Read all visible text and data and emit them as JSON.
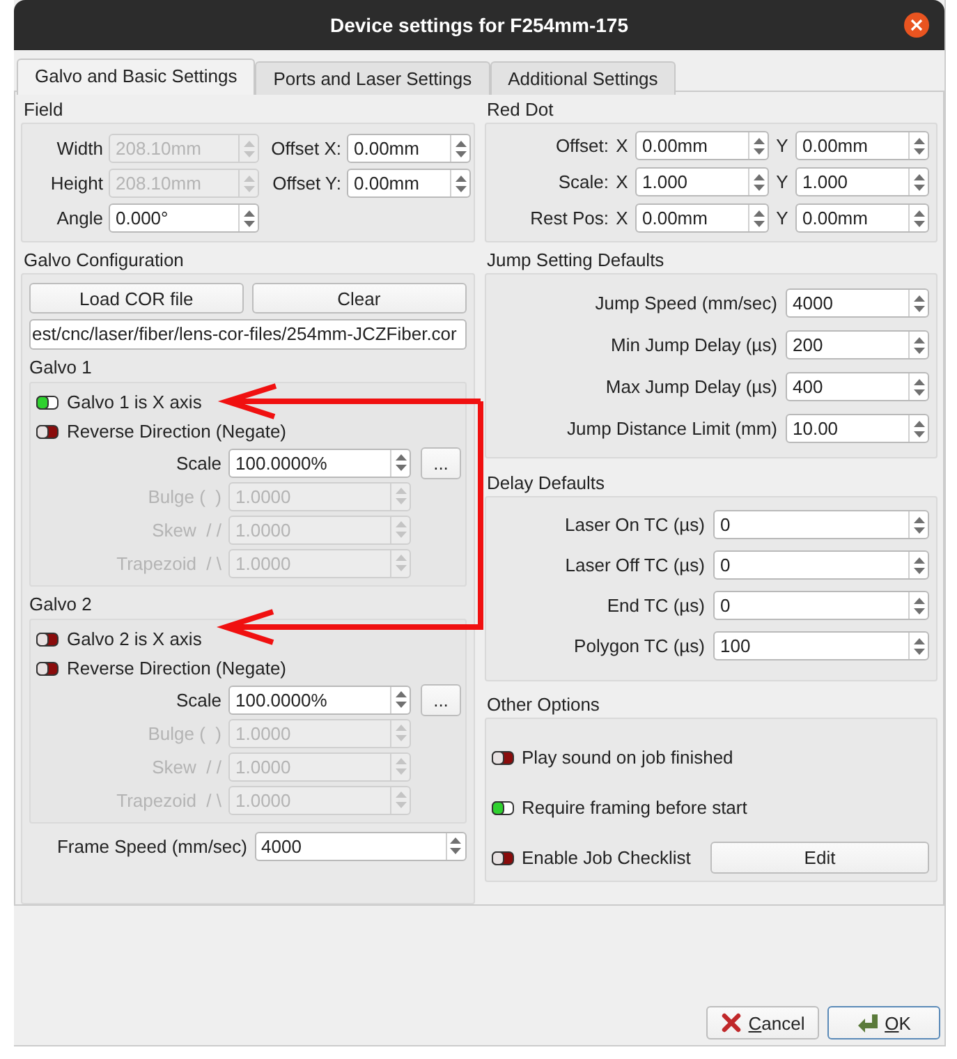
{
  "window": {
    "title": "Device settings for F254mm-175"
  },
  "tabs": [
    {
      "label": "Galvo and Basic Settings",
      "selected": true
    },
    {
      "label": "Ports and Laser Settings",
      "selected": false
    },
    {
      "label": "Additional Settings",
      "selected": false
    }
  ],
  "field": {
    "title": "Field",
    "left": [
      {
        "label": "Width",
        "value": "208.10mm",
        "disabled": true
      },
      {
        "label": "Height",
        "value": "208.10mm",
        "disabled": true
      },
      {
        "label": "Angle",
        "value": "0.000°",
        "disabled": false
      }
    ],
    "right": [
      {
        "label": "Offset X:",
        "value": "0.00mm",
        "disabled": false
      },
      {
        "label": "Offset Y:",
        "value": "0.00mm",
        "disabled": false
      }
    ]
  },
  "galvo_configuration": {
    "title": "Galvo Configuration",
    "buttons": [
      "Load COR file",
      "Clear"
    ],
    "path": "est/cnc/laser/fiber/lens-cor-files/254mm-JCZFiber.cor",
    "galvos": [
      {
        "title": "Galvo 1",
        "toggles": [
          {
            "label": "Galvo 1 is X axis",
            "checked": true
          },
          {
            "label": "Reverse Direction (Negate)",
            "checked": false
          }
        ],
        "params": [
          {
            "label": "Scale",
            "value": "100.0000%",
            "disabled": false,
            "button": "..."
          },
          {
            "label": "Bulge (  )",
            "value": "1.0000",
            "disabled": true
          },
          {
            "label": "Skew  / /",
            "value": "1.0000",
            "disabled": true
          },
          {
            "label": "Trapezoid  / \\",
            "value": "1.0000",
            "disabled": true
          }
        ]
      },
      {
        "title": "Galvo 2",
        "toggles": [
          {
            "label": "Galvo 2 is X axis",
            "checked": false
          },
          {
            "label": "Reverse Direction (Negate)",
            "checked": false
          }
        ],
        "params": [
          {
            "label": "Scale",
            "value": "100.0000%",
            "disabled": false,
            "button": "..."
          },
          {
            "label": "Bulge (  )",
            "value": "1.0000",
            "disabled": true
          },
          {
            "label": "Skew  / /",
            "value": "1.0000",
            "disabled": true
          },
          {
            "label": "Trapezoid  / \\",
            "value": "1.0000",
            "disabled": true
          }
        ]
      }
    ],
    "frame_speed": {
      "label": "Frame Speed (mm/sec)",
      "value": "4000"
    }
  },
  "red_dot": {
    "title": "Red Dot",
    "rows": [
      {
        "label": "Offset:",
        "fields": [
          {
            "axis": "X",
            "value": "0.00mm"
          },
          {
            "axis": "Y",
            "value": "0.00mm"
          }
        ]
      },
      {
        "label": "Scale:",
        "fields": [
          {
            "axis": "X",
            "value": "1.000"
          },
          {
            "axis": "Y",
            "value": "1.000"
          }
        ]
      },
      {
        "label": "Rest Pos:",
        "fields": [
          {
            "axis": "X",
            "value": "0.00mm"
          },
          {
            "axis": "Y",
            "value": "0.00mm"
          }
        ]
      }
    ]
  },
  "jump_settings": {
    "title": "Jump Setting Defaults",
    "rows": [
      {
        "label": "Jump Speed (mm/sec)",
        "value": "4000"
      },
      {
        "label": "Min Jump Delay (µs)",
        "value": "200"
      },
      {
        "label": "Max Jump Delay (µs)",
        "value": "400"
      },
      {
        "label": "Jump Distance Limit (mm)",
        "value": "10.00"
      }
    ]
  },
  "delay_defaults": {
    "title": "Delay Defaults",
    "rows": [
      {
        "label": "Laser On TC (µs)",
        "value": "0"
      },
      {
        "label": "Laser Off TC (µs)",
        "value": "0"
      },
      {
        "label": "End TC (µs)",
        "value": "0"
      },
      {
        "label": "Polygon TC (µs)",
        "value": "100"
      }
    ]
  },
  "other_options": {
    "title": "Other Options",
    "items": [
      {
        "label": "Play sound on job finished",
        "checked": false
      },
      {
        "label": "Require framing before start",
        "checked": true
      },
      {
        "label": "Enable Job Checklist",
        "checked": false,
        "button": "Edit"
      }
    ]
  },
  "dialog_buttons": [
    {
      "kind": "cancel",
      "label": "Cancel"
    },
    {
      "kind": "ok",
      "label": "OK"
    }
  ]
}
